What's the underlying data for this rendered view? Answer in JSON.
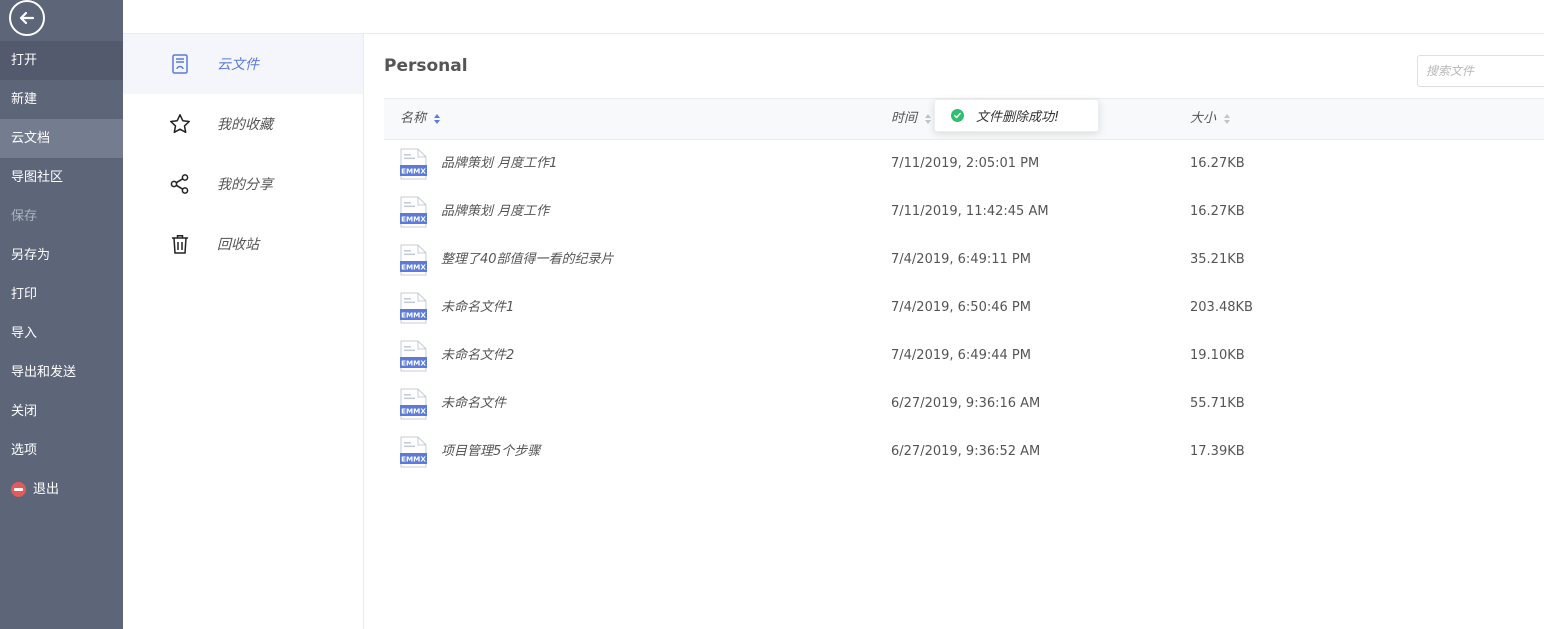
{
  "menu": {
    "items": [
      {
        "label": "打开",
        "state": "hover"
      },
      {
        "label": "新建",
        "state": ""
      },
      {
        "label": "云文档",
        "state": "active"
      },
      {
        "label": "导图社区",
        "state": ""
      },
      {
        "label": "保存",
        "state": "disabled"
      },
      {
        "label": "另存为",
        "state": ""
      },
      {
        "label": "打印",
        "state": ""
      },
      {
        "label": "导入",
        "state": ""
      },
      {
        "label": "导出和发送",
        "state": ""
      },
      {
        "label": "关闭",
        "state": ""
      },
      {
        "label": "选项",
        "state": ""
      },
      {
        "label": "退出",
        "state": "exit"
      }
    ]
  },
  "subnav": {
    "items": [
      {
        "label": "云文件",
        "icon": "cloud-file-icon",
        "active": true
      },
      {
        "label": "我的收藏",
        "icon": "star-icon",
        "active": false
      },
      {
        "label": "我的分享",
        "icon": "share-icon",
        "active": false
      },
      {
        "label": "回收站",
        "icon": "trash-icon",
        "active": false
      }
    ]
  },
  "main": {
    "title": "Personal",
    "search_placeholder": "搜索文件",
    "columns": {
      "name": "名称",
      "time": "时间",
      "size": "大小"
    },
    "files": [
      {
        "name": "品牌策划 月度工作1",
        "time": "7/11/2019, 2:05:01 PM",
        "size": "16.27KB"
      },
      {
        "name": "品牌策划 月度工作",
        "time": "7/11/2019, 11:42:45 AM",
        "size": "16.27KB"
      },
      {
        "name": "整理了40部值得一看的纪录片",
        "time": "7/4/2019, 6:49:11 PM",
        "size": "35.21KB"
      },
      {
        "name": "未命名文件1",
        "time": "7/4/2019, 6:50:46 PM",
        "size": "203.48KB"
      },
      {
        "name": "未命名文件2",
        "time": "7/4/2019, 6:49:44 PM",
        "size": "19.10KB"
      },
      {
        "name": "未命名文件",
        "time": "6/27/2019, 9:36:16 AM",
        "size": "55.71KB"
      },
      {
        "name": "项目管理5个步骤",
        "time": "6/27/2019, 9:36:52 AM",
        "size": "17.39KB"
      }
    ],
    "file_badge": "EMMX"
  },
  "toast": {
    "message": "文件删除成功!"
  },
  "colors": {
    "menu_bg": "#5d6579",
    "accent": "#5a7bd8",
    "success": "#2fbf71"
  }
}
